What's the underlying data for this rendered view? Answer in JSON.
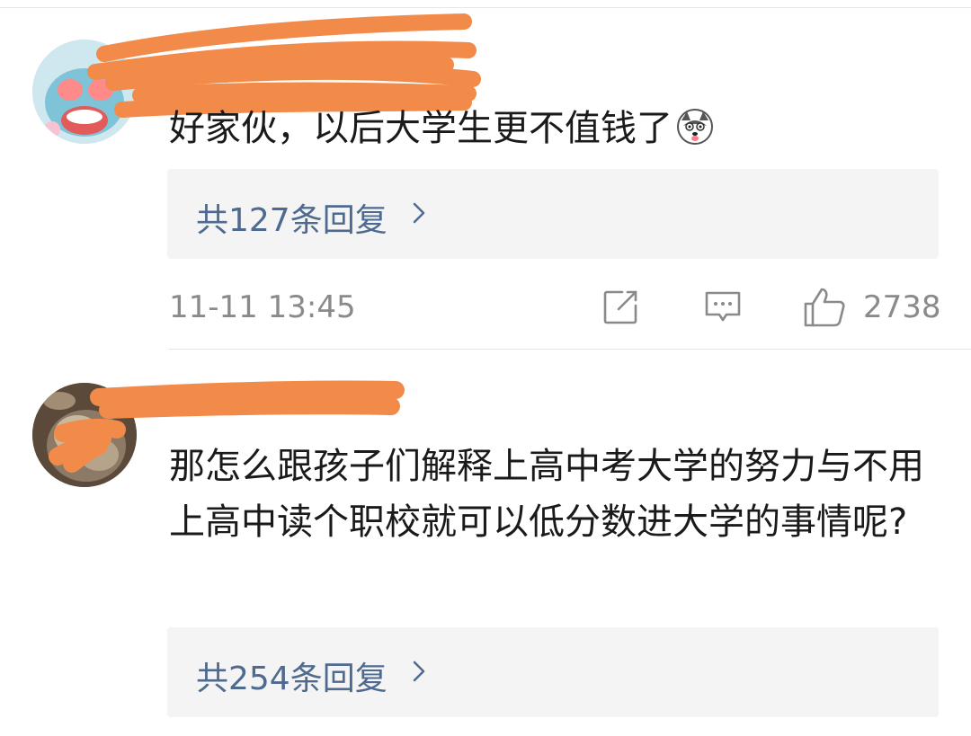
{
  "comments": [
    {
      "username": "",
      "text": "好家伙，以后大学生更不值钱了",
      "emoji_icon": "husky-dog-emoji-icon",
      "reply_summary": "共127条回复",
      "timestamp": "11-11 13:45",
      "like_count": "2738"
    },
    {
      "username": "",
      "text": "那怎么跟孩子们解释上高中考大学的努力与不用上高中读个职校就可以低分数进大学的事情呢?",
      "reply_summary": "共254条回复"
    }
  ],
  "icons": {
    "forward": "share-forward-icon",
    "comment": "comment-bubble-icon",
    "like": "thumbs-up-icon",
    "chevron": "chevron-right-icon"
  },
  "colors": {
    "reply_link": "#4e6a8f",
    "redaction": "#f28a4a",
    "meta_text": "#8a8a8a"
  }
}
